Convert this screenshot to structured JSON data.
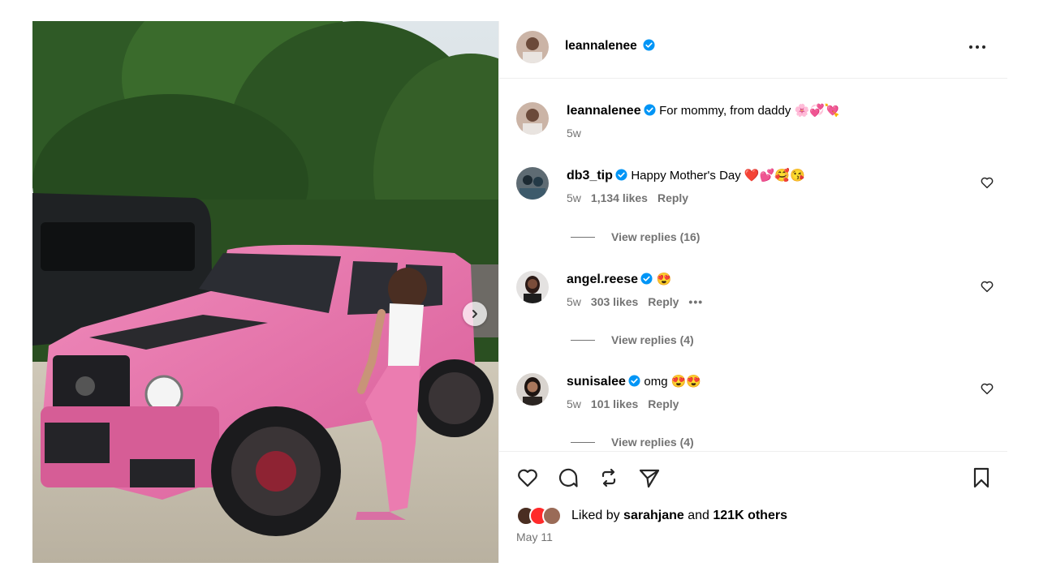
{
  "post": {
    "author": "leannalenee",
    "more_label": "More options",
    "caption": {
      "username": "leannalenee",
      "text": "For mommy, from daddy 🌸💞💘",
      "time": "5w"
    },
    "comments": [
      {
        "username": "db3_tip",
        "text": "Happy Mother's Day ❤️💕🥰😘",
        "time": "5w",
        "likes": "1,134 likes",
        "reply": "Reply",
        "view_replies": "View replies (16)"
      },
      {
        "username": "angel.reese",
        "text": "😍",
        "time": "5w",
        "likes": "303 likes",
        "reply": "Reply",
        "more": "•••",
        "view_replies": "View replies (4)"
      },
      {
        "username": "sunisalee",
        "text": "omg 😍😍",
        "time": "5w",
        "likes": "101 likes",
        "reply": "Reply",
        "view_replies": "View replies (4)"
      }
    ],
    "liked_by": {
      "prefix": "Liked by",
      "user": "sarahjane",
      "joiner": "and",
      "others": "121K others"
    },
    "date": "May 11"
  },
  "icons": {
    "header": [
      "verified-icon",
      "more-horizontal-icon"
    ],
    "media": [
      "chevron-right-icon"
    ],
    "comment": [
      "heart-icon"
    ],
    "actions": [
      "like-icon",
      "comment-icon",
      "share-icon",
      "send-icon",
      "bookmark-icon"
    ]
  },
  "colors": {
    "verified": "#0095f6",
    "muted_text": "#737373",
    "divider": "#efefef",
    "car_pink": "#e56fa6"
  }
}
